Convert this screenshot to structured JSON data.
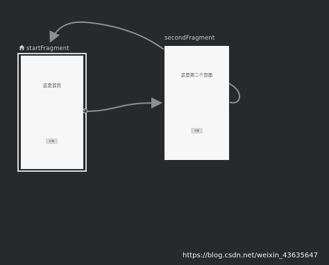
{
  "graph": {
    "start_destination": {
      "label": "startFragment",
      "screen_text": "这是首页",
      "button_text": "切换"
    },
    "second_destination": {
      "label": "secondFragment",
      "screen_text": "这是第二个页面",
      "button_text": "切换"
    }
  },
  "watermark": "https://blog.csdn.net/weixin_43635647",
  "icons": {
    "start_marker": "home-icon"
  }
}
